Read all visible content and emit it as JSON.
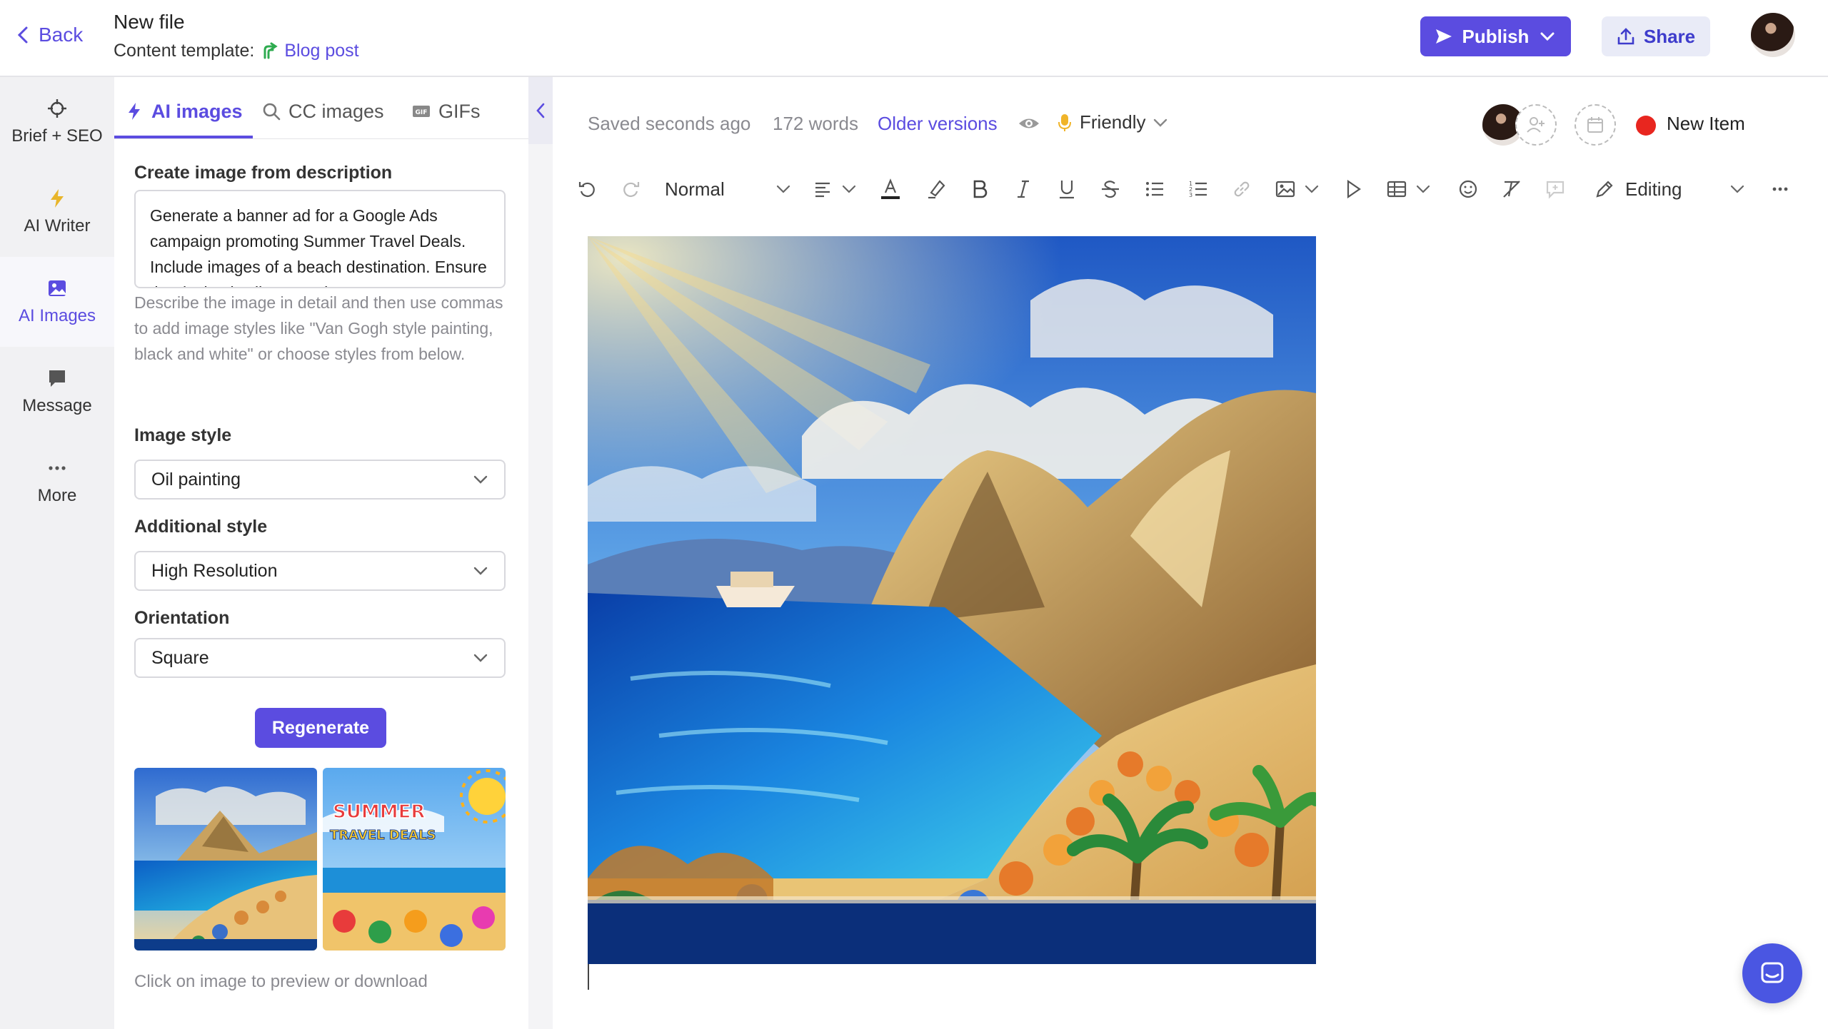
{
  "header": {
    "back_label": "Back",
    "file_title": "New file",
    "template_prefix": "Content template:",
    "template_name": "Blog post",
    "publish_label": "Publish",
    "share_label": "Share"
  },
  "leftnav": {
    "items": [
      {
        "label": "Brief + SEO",
        "icon": "target-icon"
      },
      {
        "label": "AI Writer",
        "icon": "lightning-icon"
      },
      {
        "label": "AI Images",
        "icon": "image-icon"
      },
      {
        "label": "Message",
        "icon": "chat-bubble-icon"
      },
      {
        "label": "More",
        "icon": "more-dots-icon"
      }
    ],
    "active": "AI Images"
  },
  "panel": {
    "tabs": [
      {
        "label": "AI images",
        "icon": "lightning-icon"
      },
      {
        "label": "CC images",
        "icon": "search-icon"
      },
      {
        "label": "GIFs",
        "icon": "gif-icon"
      }
    ],
    "create_label": "Create image from description",
    "description_value": "Generate a banner ad for a Google Ads campaign promoting Summer Travel Deals. Include images of a beach destination. Ensure the design is vibrant and eye",
    "help_text": "Describe the image in detail and then use commas to add image styles like \"Van Gogh style painting, black and white\" or choose styles from below.",
    "image_style_label": "Image style",
    "image_style_value": "Oil painting",
    "additional_style_label": "Additional style",
    "additional_style_value": "High Resolution",
    "orientation_label": "Orientation",
    "orientation_value": "Square",
    "regenerate_label": "Regenerate",
    "thumb_hint": "Click on image to preview or download",
    "thumb2_text": "SUMMER TRAVEL DEALS"
  },
  "editor": {
    "saved_text": "Saved seconds ago",
    "word_count": "172 words",
    "older_versions": "Older versions",
    "tone": "Friendly",
    "status_label": "New Item",
    "text_style": "Normal",
    "mode": "Editing"
  },
  "colors": {
    "accent": "#5b4ce0",
    "status_dot": "#e8261f",
    "chat_fab": "#4a56e2"
  }
}
